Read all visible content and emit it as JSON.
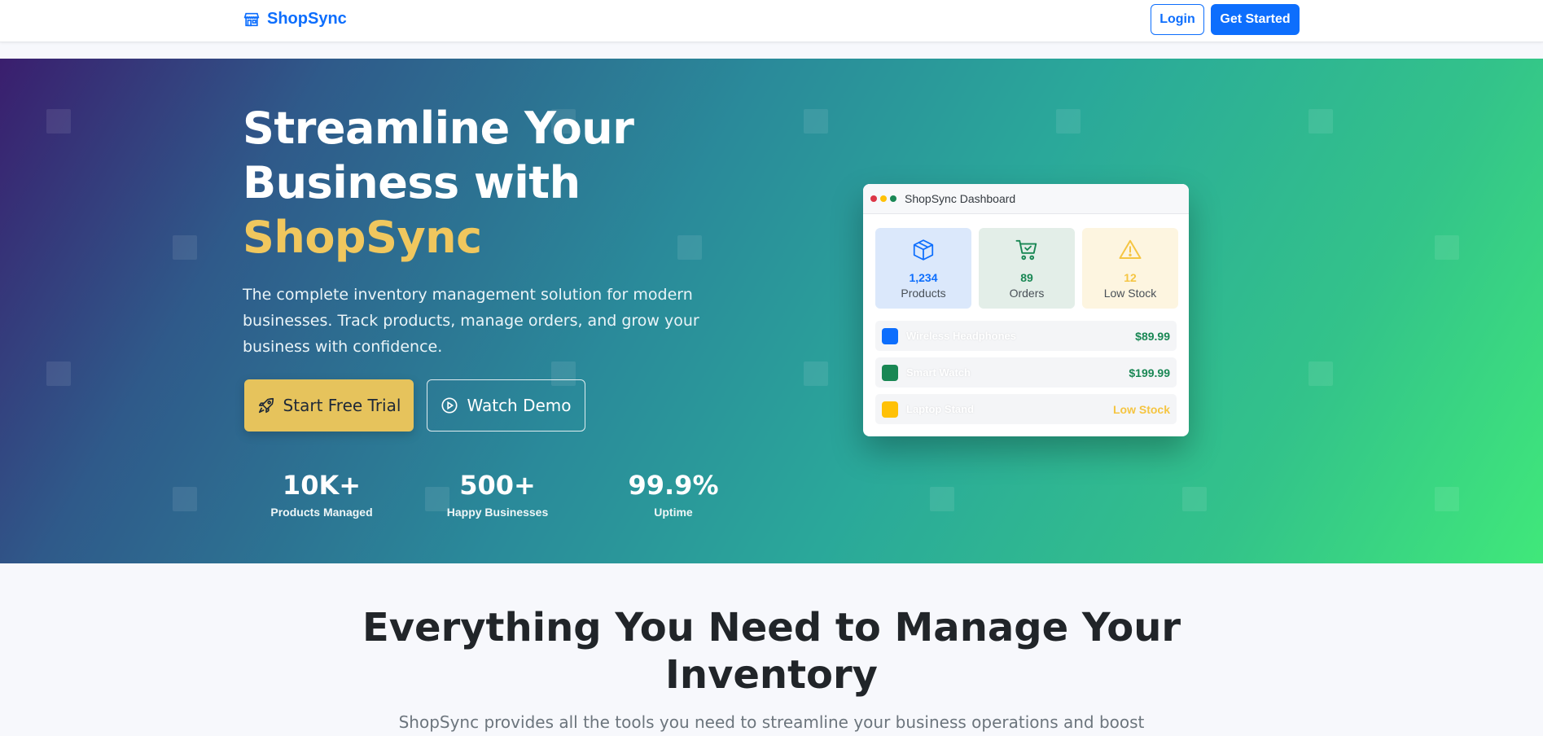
{
  "navbar": {
    "brand": "ShopSync",
    "login_label": "Login",
    "get_started_label": "Get Started"
  },
  "hero": {
    "title_line1": "Streamline Your",
    "title_line2": "Business with",
    "title_accent": "ShopSync",
    "subtitle": "The complete inventory management solution for modern businesses. Track products, manage orders, and grow your business with confidence.",
    "trial_label": "Start Free Trial",
    "demo_label": "Watch Demo",
    "stats": [
      {
        "value": "10K+",
        "label": "Products Managed"
      },
      {
        "value": "500+",
        "label": "Happy Businesses"
      },
      {
        "value": "99.9%",
        "label": "Uptime"
      }
    ]
  },
  "dashboard": {
    "title": "ShopSync Dashboard",
    "window_dot_colors": [
      "#dc3545",
      "#ffc107",
      "#198754"
    ],
    "tiles": [
      {
        "value": "1,234",
        "label": "Products",
        "icon": "box-icon",
        "bg": "#dbe8fb",
        "color": "#0d6efd"
      },
      {
        "value": "89",
        "label": "Orders",
        "icon": "cart-check-icon",
        "bg": "#e3eee8",
        "color": "#198754"
      },
      {
        "value": "12",
        "label": "Low Stock",
        "icon": "warning-icon",
        "bg": "#fdf5e0",
        "color": "#f5c542"
      }
    ],
    "rows": [
      {
        "name": "Wireless Headphones",
        "value": "$89.99",
        "swatch": "#0d6efd",
        "value_color": "#198754"
      },
      {
        "name": "Smart Watch",
        "value": "$199.99",
        "swatch": "#198754",
        "value_color": "#198754"
      },
      {
        "name": "Laptop Stand",
        "value": "Low Stock",
        "swatch": "#ffc107",
        "value_color": "#f5c542"
      }
    ]
  },
  "features": {
    "title_line1": "Everything You Need to Manage Your",
    "title_line2": "Inventory",
    "subtitle": "ShopSync provides all the tools you need to streamline your business operations and boost"
  },
  "colors": {
    "primary": "#0d6efd",
    "accent_gold": "#e6c35c",
    "hero_gradient_start": "#3a1e6e",
    "hero_gradient_end": "#40e87a"
  }
}
